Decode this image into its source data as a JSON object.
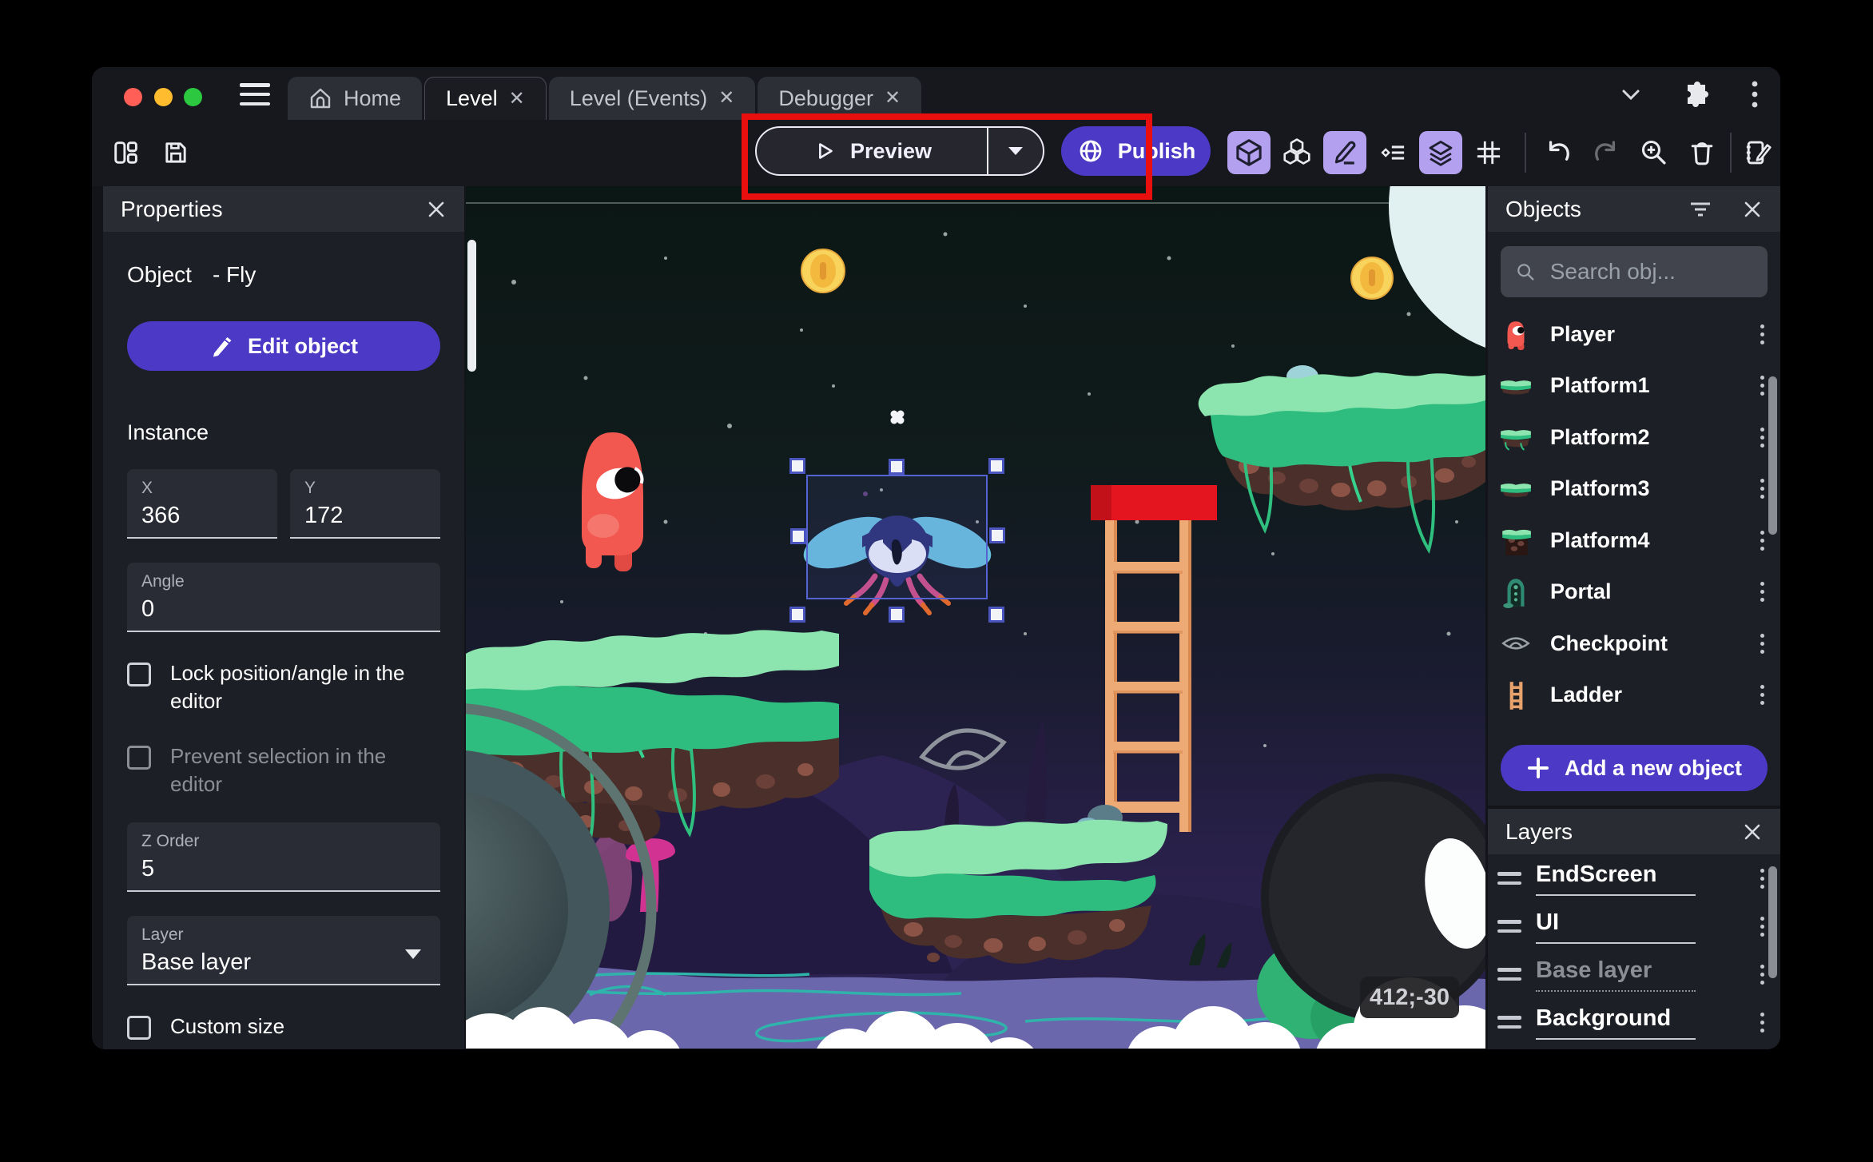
{
  "colors": {
    "accent_purple": "#4c39c6",
    "toolbar_toggle_bg": "#b3a0ef",
    "selection_blue": "#5663d2",
    "annotation_red": "#e90f0f",
    "traffic_red": "#ff5f57",
    "traffic_yellow": "#febc2e",
    "traffic_green": "#2bc840"
  },
  "titlebar": {
    "tabs": [
      {
        "label": "Home"
      },
      {
        "label": "Level"
      },
      {
        "label": "Level (Events)"
      },
      {
        "label": "Debugger"
      }
    ]
  },
  "toolbar": {
    "preview_label": "Preview",
    "publish_label": "Publish"
  },
  "properties": {
    "title": "Properties",
    "object_prefix": "Object",
    "object_name": "- Fly",
    "edit_object_label": "Edit object",
    "instance_heading": "Instance",
    "x_label": "X",
    "x_value": "366",
    "y_label": "Y",
    "y_value": "172",
    "angle_label": "Angle",
    "angle_value": "0",
    "lock_label": "Lock position/angle in the editor",
    "prevent_label": "Prevent selection in the editor",
    "zorder_label": "Z Order",
    "zorder_value": "5",
    "layer_label": "Layer",
    "layer_value": "Base layer",
    "custom_size_label": "Custom size"
  },
  "objects": {
    "title": "Objects",
    "search_placeholder": "Search obj...",
    "items": [
      {
        "name": "Player"
      },
      {
        "name": "Platform1"
      },
      {
        "name": "Platform2"
      },
      {
        "name": "Platform3"
      },
      {
        "name": "Platform4"
      },
      {
        "name": "Portal"
      },
      {
        "name": "Checkpoint"
      },
      {
        "name": "Ladder"
      }
    ],
    "add_label": "Add a new object"
  },
  "layers": {
    "title": "Layers",
    "items": [
      {
        "name": "EndScreen"
      },
      {
        "name": "UI"
      },
      {
        "name": "Base layer"
      },
      {
        "name": "Background"
      }
    ]
  },
  "canvas": {
    "coordinates": "412;-30"
  }
}
